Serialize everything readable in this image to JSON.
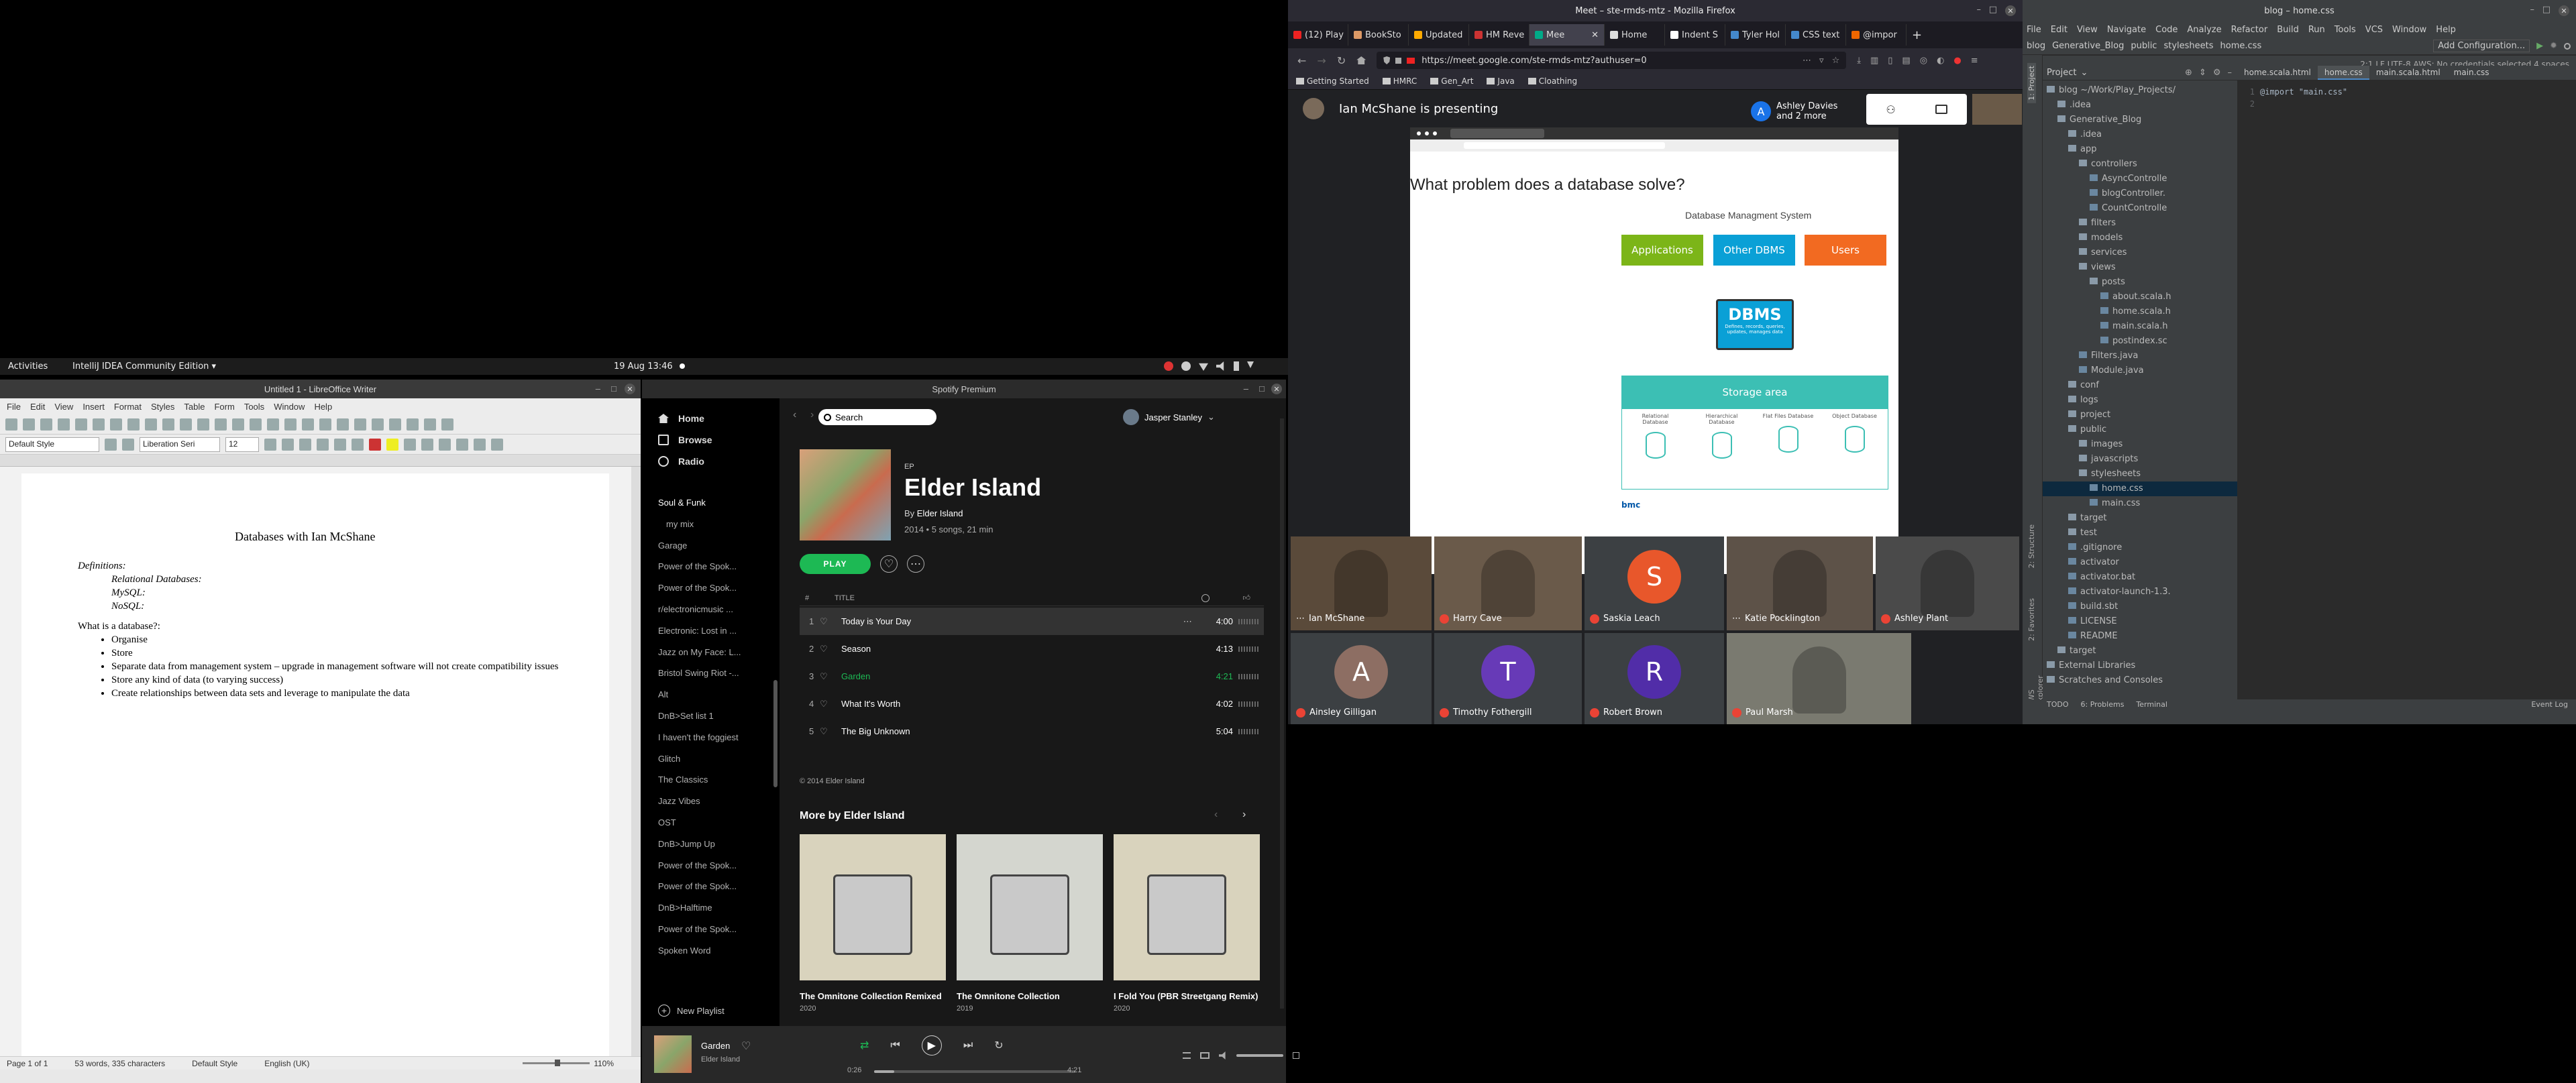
{
  "gnome": {
    "activities": "Activities",
    "app": "IntelliJ IDEA Community Edition ▾",
    "clock": "19 Aug 13:46"
  },
  "writer": {
    "title": "Untitled 1 - LibreOffice Writer",
    "menu": [
      "File",
      "Edit",
      "View",
      "Insert",
      "Format",
      "Styles",
      "Table",
      "Form",
      "Tools",
      "Window",
      "Help"
    ],
    "style": "Default Style",
    "font": "Liberation Seri",
    "size": "12",
    "doc_title": "Databases with Ian McShane",
    "definitions": "Definitions:",
    "def_items": [
      "Relational Databases:",
      "MySQL:",
      "NoSQL:"
    ],
    "question": "What is a database?:",
    "bullets": [
      "Organise",
      "Store",
      "Separate data from management system – upgrade in management software will not create compatibility issues",
      "Store any kind of data (to varying success)",
      "Create relationships between data sets and leverage to manipulate the data"
    ],
    "status": {
      "page": "Page 1 of 1",
      "words": "53 words, 335 characters",
      "style": "Default Style",
      "lang": "English (UK)",
      "zoom": "110%"
    }
  },
  "spotify": {
    "title": "Spotify Premium",
    "nav": [
      "Home",
      "Browse",
      "Radio"
    ],
    "playlists": [
      "Soul & Funk",
      "my mix",
      "Garage",
      "Power of the Spok...",
      "Power of the Spok...",
      "r/electronicmusic ...",
      "Electronic: Lost in ...",
      "Jazz on My Face: L...",
      "Bristol Swing Riot -...",
      "Alt",
      "DnB>Set list 1",
      "I haven't the foggiest",
      "Glitch",
      "The Classics",
      "Jazz Vibes",
      "OST",
      "DnB>Jump Up",
      "Power of the Spok...",
      "Power of the Spok...",
      "DnB>Halftime",
      "Power of the Spok...",
      "Spoken Word"
    ],
    "new_playlist": "New Playlist",
    "search": "Search",
    "user": "Jasper Stanley",
    "album": {
      "type": "EP",
      "name": "Elder Island",
      "by": "By",
      "artist": "Elder Island",
      "meta": "2014 • 5 songs, 21 min"
    },
    "play": "PLAY",
    "cols": {
      "num": "#",
      "title": "TITLE"
    },
    "tracks": [
      {
        "n": "1",
        "title": "Today is Your Day",
        "time": "4:00"
      },
      {
        "n": "2",
        "title": "Season",
        "time": "4:13"
      },
      {
        "n": "3",
        "title": "Garden",
        "time": "4:21"
      },
      {
        "n": "4",
        "title": "What It's Worth",
        "time": "4:02"
      },
      {
        "n": "5",
        "title": "The Big Unknown",
        "time": "5:04"
      }
    ],
    "copyright": "© 2014 Elder Island",
    "more": "More by Elder Island",
    "albums": [
      {
        "name": "The Omnitone Collection Remixed",
        "year": "2020"
      },
      {
        "name": "The Omnitone Collection",
        "year": "2019"
      },
      {
        "name": "I Fold You (PBR Streetgang Remix)",
        "year": "2020"
      }
    ],
    "now": {
      "title": "Garden",
      "artist": "Elder Island",
      "elapsed": "0:26",
      "total": "4:21",
      "progress": 0.1
    }
  },
  "firefox": {
    "title": "Meet – ste-rmds-mtz - Mozilla Firefox",
    "tabs": [
      "(12) Play",
      "BookSto",
      "Updated",
      "HM Reve",
      "Mee",
      "Home",
      "Indent S",
      "Tyler Hol",
      "CSS text",
      "@impor"
    ],
    "url": "https://meet.google.com/ste-rmds-mtz?authuser=0",
    "bookmarks": [
      "Getting Started",
      "HMRC",
      "Gen_Art",
      "Java",
      "Cloathing"
    ]
  },
  "meet": {
    "presenting": "Ian McShane is presenting",
    "attendees": "Ashley Davies and 2 more",
    "slide": {
      "title": "What problem does a database solve?",
      "dbms_header": "Database Managment System",
      "boxes": [
        "Applications",
        "Other DBMS",
        "Users"
      ],
      "dbms": "DBMS",
      "dbms_sub": "Defines, records, queries, updates, manages data",
      "storage": "Storage area",
      "db_types": [
        "Relational Database",
        "Hierarchical Database",
        "Flat Files Database",
        "Object Database"
      ],
      "logo": "bmc"
    },
    "participants": [
      {
        "name": "Ian McShane",
        "initial": "",
        "color": "#5a4a3a"
      },
      {
        "name": "Harry Cave",
        "initial": "",
        "color": "#6a5a4a"
      },
      {
        "name": "Saskia Leach",
        "initial": "S",
        "color": "#e8572b"
      },
      {
        "name": "Katie Pocklington",
        "initial": "",
        "color": "#5d5248"
      },
      {
        "name": "Ashley Plant",
        "initial": "",
        "color": "#4a4a4a"
      },
      {
        "name": "Ainsley Gilligan",
        "initial": "A",
        "color": "#8d6e63"
      },
      {
        "name": "Timothy Fothergill",
        "initial": "T",
        "color": "#673ab7"
      },
      {
        "name": "Robert Brown",
        "initial": "R",
        "color": "#512da8"
      },
      {
        "name": "Paul Marsh",
        "initial": "",
        "color": "#7a7a70"
      }
    ]
  },
  "intellij": {
    "title": "blog – home.css",
    "menu": [
      "File",
      "Edit",
      "View",
      "Navigate",
      "Code",
      "Analyze",
      "Refactor",
      "Build",
      "Run",
      "Tools",
      "VCS",
      "Window",
      "Help"
    ],
    "breadcrumb": [
      "blog",
      "Generative_Blog",
      "public",
      "stylesheets",
      "home.css"
    ],
    "run_config": "Add Configuration...",
    "project_label": "Project",
    "tabs": [
      "home.scala.html",
      "home.css",
      "main.scala.html",
      "main.css"
    ],
    "code": "@import \"main.css\"",
    "tree": [
      {
        "d": 0,
        "t": "blog  ~/Work/Play_Projects/",
        "f": true
      },
      {
        "d": 1,
        "t": ".idea",
        "f": true
      },
      {
        "d": 1,
        "t": "Generative_Blog",
        "f": true
      },
      {
        "d": 2,
        "t": ".idea",
        "f": true
      },
      {
        "d": 2,
        "t": "app",
        "f": true
      },
      {
        "d": 3,
        "t": "controllers",
        "f": true
      },
      {
        "d": 4,
        "t": "AsyncControlle",
        "f": false
      },
      {
        "d": 4,
        "t": "blogController.",
        "f": false
      },
      {
        "d": 4,
        "t": "CountControlle",
        "f": false
      },
      {
        "d": 3,
        "t": "filters",
        "f": true
      },
      {
        "d": 3,
        "t": "models",
        "f": true
      },
      {
        "d": 3,
        "t": "services",
        "f": true
      },
      {
        "d": 3,
        "t": "views",
        "f": true
      },
      {
        "d": 4,
        "t": "posts",
        "f": true
      },
      {
        "d": 5,
        "t": "about.scala.h",
        "f": false
      },
      {
        "d": 5,
        "t": "home.scala.h",
        "f": false
      },
      {
        "d": 5,
        "t": "main.scala.h",
        "f": false
      },
      {
        "d": 5,
        "t": "postindex.sc",
        "f": false
      },
      {
        "d": 3,
        "t": "Filters.java",
        "f": false
      },
      {
        "d": 3,
        "t": "Module.java",
        "f": false
      },
      {
        "d": 2,
        "t": "conf",
        "f": true
      },
      {
        "d": 2,
        "t": "logs",
        "f": true
      },
      {
        "d": 2,
        "t": "project",
        "f": true
      },
      {
        "d": 2,
        "t": "public",
        "f": true
      },
      {
        "d": 3,
        "t": "images",
        "f": true
      },
      {
        "d": 3,
        "t": "javascripts",
        "f": true
      },
      {
        "d": 3,
        "t": "stylesheets",
        "f": true
      },
      {
        "d": 4,
        "t": "home.css",
        "f": false,
        "sel": true
      },
      {
        "d": 4,
        "t": "main.css",
        "f": false
      },
      {
        "d": 2,
        "t": "target",
        "f": true
      },
      {
        "d": 2,
        "t": "test",
        "f": true
      },
      {
        "d": 2,
        "t": ".gitignore",
        "f": false
      },
      {
        "d": 2,
        "t": "activator",
        "f": false
      },
      {
        "d": 2,
        "t": "activator.bat",
        "f": false
      },
      {
        "d": 2,
        "t": "activator-launch-1.3.",
        "f": false
      },
      {
        "d": 2,
        "t": "build.sbt",
        "f": false
      },
      {
        "d": 2,
        "t": "LICENSE",
        "f": false
      },
      {
        "d": 2,
        "t": "README",
        "f": false
      },
      {
        "d": 1,
        "t": "target",
        "f": true
      },
      {
        "d": 0,
        "t": "External Libraries",
        "f": true
      },
      {
        "d": 0,
        "t": "Scratches and Consoles",
        "f": true
      }
    ],
    "bottom_tabs": [
      "TODO",
      "6: Problems",
      "Terminal"
    ],
    "event_log": "Event Log",
    "status": "2:1  LF  UTF-8  AWS: No credentials selected  4 spaces",
    "side_tabs": [
      "1: Project",
      "2: Structure",
      "2: Favorites",
      "AWS Explorer"
    ]
  }
}
